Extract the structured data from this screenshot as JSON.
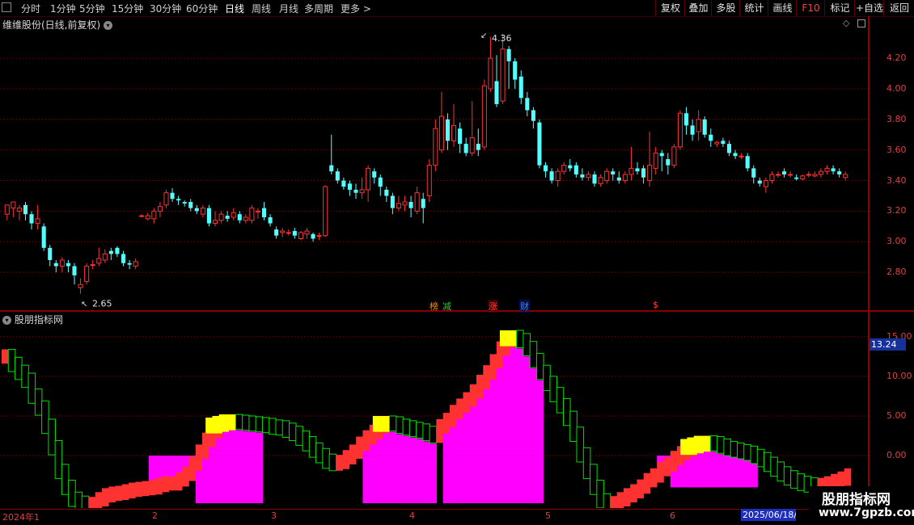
{
  "toolbar": {
    "periods": [
      "分时",
      "1分钟",
      "5分钟",
      "15分钟",
      "30分钟",
      "60分钟",
      "日线",
      "周线",
      "月线",
      "多周期",
      "更多 >"
    ],
    "active_period": "日线",
    "right_buttons": [
      "复权",
      "叠加",
      "多股",
      "统计",
      "画线",
      "F10",
      "标记",
      "+自选",
      "返回"
    ]
  },
  "main_chart": {
    "title": "维维股份(日线,前复权)",
    "high_label": "4.36",
    "low_label": "2.65",
    "y_ticks": [
      "4.20",
      "4.00",
      "3.80",
      "3.60",
      "3.40",
      "3.20",
      "3.00",
      "2.80"
    ],
    "events": [
      {
        "text": "榜",
        "color": "#ff8800"
      },
      {
        "text": "减",
        "color": "#40c040"
      },
      {
        "text": "涨",
        "color": "#ff4040"
      },
      {
        "text": "财",
        "color": "#4080ff"
      },
      {
        "text": "$",
        "color": "#ff4040"
      }
    ]
  },
  "indicator": {
    "title": "股朋指标网",
    "y_ticks": [
      "15.00",
      "10.00",
      "5.00",
      "0.00"
    ],
    "current_value": "13.24"
  },
  "x_axis": {
    "labels": [
      "2024年1",
      "2",
      "3",
      "4",
      "5",
      "6"
    ],
    "cursor_date": "2025/06/18/三"
  },
  "watermark": {
    "line1": "股朋指标网",
    "line2": "www.7gpzb.com"
  },
  "colors": {
    "up": "#ff3232",
    "down": "#54ffff",
    "grid": "#7a0000",
    "magenta": "#ff00ff",
    "yellow": "#ffff00",
    "green": "#00e000"
  },
  "chart_data": [
    {
      "type": "candlestick",
      "title": "维维股份(日线,前复权)",
      "ylim": [
        2.6,
        4.38
      ],
      "y_ticks": [
        2.8,
        3.0,
        3.2,
        3.4,
        3.6,
        3.8,
        4.0,
        4.2
      ],
      "ohlc": [
        [
          3.18,
          3.24,
          3.22,
          3.14
        ],
        [
          3.22,
          3.26,
          3.24,
          3.16
        ],
        [
          3.2,
          3.22,
          3.24,
          3.14
        ],
        [
          3.24,
          3.18,
          3.26,
          3.14
        ],
        [
          3.18,
          3.12,
          3.2,
          3.08
        ],
        [
          3.12,
          3.15,
          3.24,
          3.08
        ],
        [
          3.1,
          2.96,
          3.12,
          2.94
        ],
        [
          2.96,
          2.88,
          2.98,
          2.84
        ],
        [
          2.86,
          2.84,
          2.88,
          2.8
        ],
        [
          2.84,
          2.88,
          2.9,
          2.8
        ],
        [
          2.86,
          2.84,
          2.88,
          2.8
        ],
        [
          2.84,
          2.78,
          2.86,
          2.72
        ],
        [
          2.7,
          2.72,
          2.76,
          2.66
        ],
        [
          2.74,
          2.84,
          2.86,
          2.72
        ],
        [
          2.85,
          2.85,
          2.88,
          2.82
        ],
        [
          2.86,
          2.89,
          2.96,
          2.84
        ],
        [
          2.88,
          2.92,
          2.95,
          2.86
        ],
        [
          2.94,
          2.92,
          2.96,
          2.88
        ],
        [
          2.96,
          2.92,
          2.97,
          2.9
        ],
        [
          2.92,
          2.86,
          2.94,
          2.84
        ],
        [
          2.86,
          2.85,
          2.88,
          2.82
        ],
        [
          2.84,
          2.87,
          2.89,
          2.82
        ],
        [
          3.17,
          3.17,
          3.18,
          3.16
        ],
        [
          3.15,
          3.17,
          3.19,
          3.14
        ],
        [
          3.15,
          3.2,
          3.22,
          3.12
        ],
        [
          3.2,
          3.23,
          3.26,
          3.16
        ],
        [
          3.24,
          3.32,
          3.34,
          3.22
        ],
        [
          3.32,
          3.28,
          3.35,
          3.26
        ],
        [
          3.28,
          3.27,
          3.3,
          3.24
        ],
        [
          3.26,
          3.25,
          3.27,
          3.23
        ],
        [
          3.26,
          3.22,
          3.28,
          3.2
        ],
        [
          3.22,
          3.2,
          3.24,
          3.18
        ],
        [
          3.18,
          3.22,
          3.24,
          3.16
        ],
        [
          3.22,
          3.12,
          3.24,
          3.1
        ],
        [
          3.12,
          3.14,
          3.2,
          3.1
        ],
        [
          3.14,
          3.18,
          3.2,
          3.12
        ],
        [
          3.17,
          3.15,
          3.2,
          3.13
        ],
        [
          3.16,
          3.19,
          3.22,
          3.14
        ],
        [
          3.18,
          3.14,
          3.2,
          3.12
        ],
        [
          3.14,
          3.16,
          3.18,
          3.12
        ],
        [
          3.14,
          3.22,
          3.24,
          3.12
        ],
        [
          3.2,
          3.2,
          3.22,
          3.15
        ],
        [
          3.22,
          3.16,
          3.26,
          3.14
        ],
        [
          3.16,
          3.12,
          3.18,
          3.1
        ],
        [
          3.08,
          3.04,
          3.1,
          3.02
        ],
        [
          3.06,
          3.07,
          3.09,
          3.03
        ],
        [
          3.06,
          3.06,
          3.08,
          3.04
        ],
        [
          3.07,
          3.04,
          3.09,
          3.02
        ],
        [
          3.02,
          3.06,
          3.07,
          3.01
        ],
        [
          3.05,
          3.07,
          3.09,
          3.02
        ],
        [
          3.05,
          3.02,
          3.06,
          3.0
        ],
        [
          3.04,
          3.04,
          3.06,
          3.01
        ],
        [
          3.04,
          3.36,
          3.37,
          3.03
        ],
        [
          3.5,
          3.46,
          3.7,
          3.44
        ],
        [
          3.46,
          3.4,
          3.48,
          3.38
        ],
        [
          3.4,
          3.36,
          3.42,
          3.34
        ],
        [
          3.38,
          3.34,
          3.4,
          3.3
        ],
        [
          3.34,
          3.32,
          3.38,
          3.28
        ],
        [
          3.32,
          3.34,
          3.42,
          3.28
        ],
        [
          3.34,
          3.48,
          3.5,
          3.26
        ],
        [
          3.46,
          3.42,
          3.48,
          3.38
        ],
        [
          3.42,
          3.36,
          3.44,
          3.3
        ],
        [
          3.34,
          3.3,
          3.36,
          3.26
        ],
        [
          3.3,
          3.22,
          3.32,
          3.18
        ],
        [
          3.22,
          3.25,
          3.3,
          3.2
        ],
        [
          3.24,
          3.26,
          3.3,
          3.2
        ],
        [
          3.26,
          3.22,
          3.3,
          3.16
        ],
        [
          3.2,
          3.32,
          3.36,
          3.18
        ],
        [
          3.28,
          3.22,
          3.32,
          3.12
        ],
        [
          3.3,
          3.5,
          3.54,
          3.26
        ],
        [
          3.5,
          3.74,
          3.8,
          3.46
        ],
        [
          3.6,
          3.82,
          3.98,
          3.58
        ],
        [
          3.8,
          3.66,
          3.84,
          3.6
        ],
        [
          3.66,
          3.76,
          3.9,
          3.62
        ],
        [
          3.74,
          3.64,
          3.78,
          3.58
        ],
        [
          3.64,
          3.58,
          3.68,
          3.56
        ],
        [
          3.58,
          3.68,
          3.92,
          3.56
        ],
        [
          3.64,
          3.6,
          3.74,
          3.56
        ],
        [
          3.62,
          4.02,
          4.06,
          3.6
        ],
        [
          4.0,
          4.2,
          4.34,
          3.98
        ],
        [
          4.05,
          3.9,
          4.22,
          3.88
        ],
        [
          3.92,
          4.26,
          4.36,
          3.9
        ],
        [
          4.26,
          4.18,
          4.28,
          4.0
        ],
        [
          4.18,
          4.06,
          4.2,
          4.0
        ],
        [
          4.08,
          3.94,
          4.12,
          3.9
        ],
        [
          3.94,
          3.86,
          3.98,
          3.82
        ],
        [
          3.86,
          3.79,
          3.88,
          3.74
        ],
        [
          3.78,
          3.5,
          3.8,
          3.48
        ],
        [
          3.5,
          3.46,
          3.52,
          3.42
        ],
        [
          3.46,
          3.4,
          3.48,
          3.38
        ],
        [
          3.4,
          3.46,
          3.48,
          3.36
        ],
        [
          3.46,
          3.5,
          3.52,
          3.44
        ],
        [
          3.5,
          3.48,
          3.54,
          3.46
        ],
        [
          3.5,
          3.44,
          3.52,
          3.42
        ],
        [
          3.44,
          3.42,
          3.48,
          3.4
        ],
        [
          3.42,
          3.44,
          3.46,
          3.4
        ],
        [
          3.44,
          3.38,
          3.46,
          3.36
        ],
        [
          3.38,
          3.42,
          3.44,
          3.36
        ],
        [
          3.4,
          3.46,
          3.48,
          3.38
        ],
        [
          3.46,
          3.44,
          3.48,
          3.4
        ],
        [
          3.42,
          3.4,
          3.46,
          3.38
        ],
        [
          3.4,
          3.44,
          3.46,
          3.38
        ],
        [
          3.44,
          3.48,
          3.62,
          3.4
        ],
        [
          3.48,
          3.46,
          3.52,
          3.44
        ],
        [
          3.48,
          3.42,
          3.5,
          3.38
        ],
        [
          3.4,
          3.5,
          3.72,
          3.36
        ],
        [
          3.48,
          3.58,
          3.62,
          3.44
        ],
        [
          3.58,
          3.56,
          3.6,
          3.46
        ],
        [
          3.54,
          3.5,
          3.58,
          3.44
        ],
        [
          3.5,
          3.62,
          3.64,
          3.48
        ],
        [
          3.62,
          3.84,
          3.86,
          3.6
        ],
        [
          3.84,
          3.76,
          3.88,
          3.7
        ],
        [
          3.76,
          3.7,
          3.8,
          3.66
        ],
        [
          3.72,
          3.8,
          3.86,
          3.66
        ],
        [
          3.8,
          3.7,
          3.82,
          3.68
        ],
        [
          3.7,
          3.66,
          3.74,
          3.62
        ],
        [
          3.64,
          3.65,
          3.66,
          3.62
        ],
        [
          3.66,
          3.64,
          3.68,
          3.62
        ],
        [
          3.64,
          3.58,
          3.66,
          3.56
        ],
        [
          3.58,
          3.56,
          3.6,
          3.54
        ],
        [
          3.56,
          3.56,
          3.58,
          3.54
        ],
        [
          3.56,
          3.48,
          3.58,
          3.46
        ],
        [
          3.48,
          3.42,
          3.5,
          3.38
        ],
        [
          3.4,
          3.38,
          3.42,
          3.36
        ],
        [
          3.36,
          3.4,
          3.42,
          3.32
        ],
        [
          3.4,
          3.44,
          3.46,
          3.38
        ],
        [
          3.44,
          3.44,
          3.46,
          3.42
        ],
        [
          3.46,
          3.44,
          3.48,
          3.42
        ],
        [
          3.44,
          3.44,
          3.46,
          3.42
        ],
        [
          3.42,
          3.41,
          3.44,
          3.4
        ],
        [
          3.41,
          3.43,
          3.44,
          3.4
        ],
        [
          3.44,
          3.44,
          3.46,
          3.42
        ],
        [
          3.43,
          3.44,
          3.46,
          3.42
        ],
        [
          3.44,
          3.46,
          3.48,
          3.42
        ],
        [
          3.46,
          3.48,
          3.5,
          3.44
        ],
        [
          3.48,
          3.46,
          3.5,
          3.44
        ],
        [
          3.46,
          3.44,
          3.48,
          3.42
        ],
        [
          3.42,
          3.44,
          3.46,
          3.4
        ]
      ]
    },
    {
      "type": "bar",
      "title": "股朋指标网",
      "ylim": [
        -6.2,
        16
      ],
      "y_ticks": [
        0,
        5,
        10,
        15
      ],
      "current": 13.24,
      "line": [
        13,
        12,
        11,
        10,
        8,
        6.5,
        4.2,
        1.5,
        -1.5,
        -3.5,
        -5,
        -5.5,
        -5.8,
        -5.6,
        -5,
        -4.5,
        -4.3,
        -4.2,
        -4,
        -3.8,
        -3.7,
        -3.6,
        -3.5,
        -3.2,
        -3,
        -3,
        -2.5,
        -1.8,
        -0.5,
        1,
        2.5,
        3.6,
        4.4,
        4.6,
        4.8,
        4.7,
        4.6,
        4.5,
        4.4,
        4.3,
        4.1,
        4,
        3.7,
        3.3,
        2.7,
        2,
        1.2,
        0.5,
        -0.2,
        -0.5,
        -0.3,
        0.3,
        1,
        2,
        2.8,
        3.5,
        4.2,
        4.6,
        4.5,
        4.2,
        4,
        3.8,
        3.6,
        3.3,
        3,
        4.2,
        5,
        6,
        6.8,
        7.6,
        8.6,
        9.8,
        11,
        12.4,
        14,
        15,
        15.4,
        15,
        14,
        12.5,
        11,
        9.6,
        8.2,
        6.8,
        5.2,
        3.2,
        0.6,
        -1.5,
        -3.5,
        -5.2,
        -5.8,
        -5.5,
        -5,
        -4.5,
        -4,
        -3.4,
        -2.6,
        -2,
        -1.2,
        -0.6,
        0.2,
        0.8,
        1.3,
        1.7,
        1.9,
        2.1,
        2.0,
        1.7,
        1.4,
        1.2,
        1,
        0.8,
        0.4,
        0,
        -0.6,
        -1.2,
        -1.8,
        -2.3,
        -2.7,
        -3,
        -3.2,
        -3.3,
        -3.2,
        -3.0,
        -2.7,
        -2.4,
        -2.0
      ],
      "bars": [
        0,
        0,
        0,
        0,
        0,
        0,
        0,
        0,
        0,
        0,
        0,
        0,
        0,
        0,
        0,
        0,
        0,
        0,
        0,
        0,
        0,
        0,
        -6,
        -6,
        -6,
        -6,
        -6,
        -6,
        -6,
        -6,
        -6,
        -6,
        -6,
        -6,
        -6,
        -6,
        -6,
        -6,
        -6,
        0,
        0,
        0,
        0,
        0,
        0,
        0,
        0,
        0,
        0,
        0,
        0,
        0,
        0,
        0,
        -6,
        -6,
        -6,
        -6,
        -6,
        -6,
        -6,
        -6,
        -6,
        -6,
        -6,
        0,
        -6,
        -6,
        -6,
        -6,
        -6,
        -6,
        -6,
        -6,
        -6,
        -6,
        -6,
        -6,
        -6,
        -6,
        -6,
        0,
        0,
        0,
        0,
        0,
        0,
        0,
        0,
        0,
        0,
        0,
        0,
        0,
        0,
        0,
        0,
        0,
        -4,
        -4,
        -4,
        -4,
        -4,
        -4,
        -4,
        -4,
        -4,
        -4,
        -4,
        -4,
        -4,
        -4,
        -4,
        0,
        0,
        0,
        0,
        0,
        0,
        0,
        0,
        0,
        0,
        0,
        0,
        0,
        0,
        0,
        -2.5,
        -2.5
      ]
    }
  ]
}
